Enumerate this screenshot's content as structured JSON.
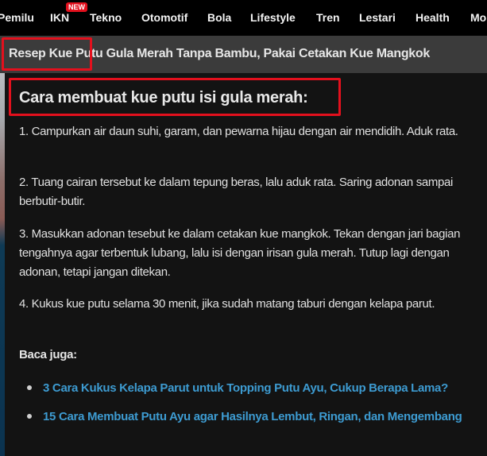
{
  "topnav": {
    "items": [
      {
        "label": "Pemilu"
      },
      {
        "label": "IKN",
        "badge": "NEW"
      },
      {
        "label": "Tekno"
      },
      {
        "label": "Otomotif"
      },
      {
        "label": "Bola"
      },
      {
        "label": "Lifestyle"
      },
      {
        "label": "Tren"
      },
      {
        "label": "Lestari"
      },
      {
        "label": "Health"
      },
      {
        "label": "Mo"
      }
    ]
  },
  "article": {
    "title": "Resep Kue Putu Gula Merah Tanpa Bambu, Pakai Cetakan Kue Mangkok",
    "section_heading": "Cara membuat kue putu isi gula merah:",
    "steps": [
      "1. Campurkan air daun suhi, garam, dan pewarna hijau dengan air mendidih. Aduk rata.",
      "2. Tuang cairan tersebut ke dalam tepung beras, lalu aduk rata. Saring adonan sampai berbutir-butir.",
      "3. Masukkan adonan tesebut ke dalam cetakan kue mangkok. Tekan dengan jari bagian tengahnya agar terbentuk lubang, lalu isi dengan irisan gula merah. Tutup lagi dengan adonan, tetapi jangan ditekan.",
      "4. Kukus kue putu selama 30 menit, jika sudah matang taburi dengan kelapa parut."
    ],
    "read_also_label": "Baca juga:",
    "related_links": [
      "3 Cara Kukus Kelapa Parut untuk Topping Putu Ayu, Cukup Berapa Lama?",
      "15 Cara Membuat Putu Ayu agar Hasilnya Lembut, Ringan, dan Mengembang"
    ]
  },
  "colors": {
    "nav_bg": "#000000",
    "title_bar_bg": "#3b3b3b",
    "content_bg": "#131313",
    "highlight_red": "#e3101d",
    "link_blue": "#3d9bd1",
    "badge_red": "#e3101d"
  }
}
